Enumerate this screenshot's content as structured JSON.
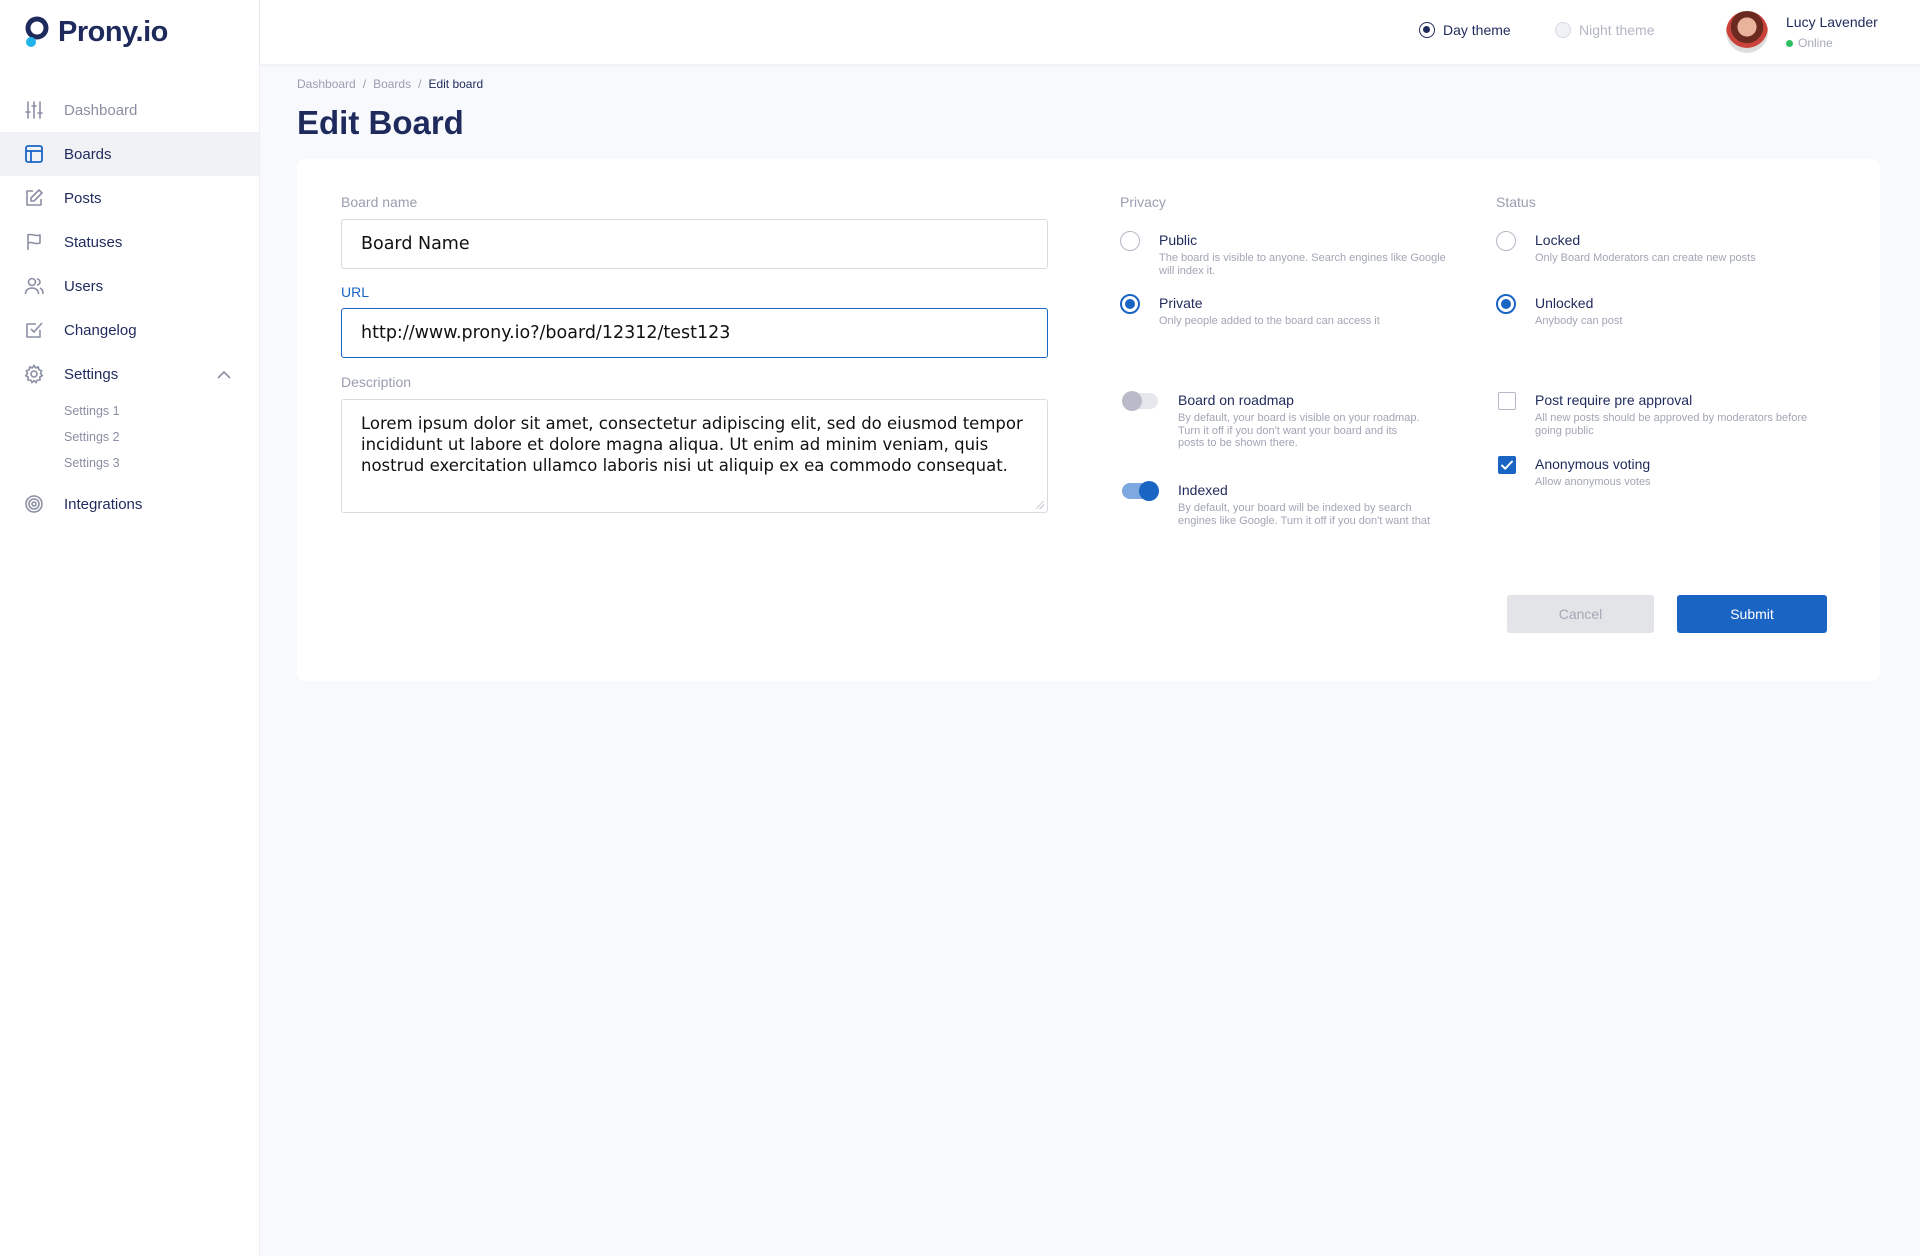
{
  "brand": {
    "name": "Prony.io"
  },
  "sidebar": {
    "items": [
      {
        "label": "Dashboard",
        "icon": "sliders-icon"
      },
      {
        "label": "Boards",
        "icon": "board-icon"
      },
      {
        "label": "Posts",
        "icon": "edit-icon"
      },
      {
        "label": "Statuses",
        "icon": "flag-icon"
      },
      {
        "label": "Users",
        "icon": "users-icon"
      },
      {
        "label": "Changelog",
        "icon": "checked-box-icon"
      },
      {
        "label": "Settings",
        "icon": "gear-icon"
      },
      {
        "label": "Integrations",
        "icon": "target-icon"
      }
    ],
    "settings_sub": [
      "Settings 1",
      "Settings 2",
      "Settings 3"
    ],
    "active": "Boards"
  },
  "header": {
    "day_theme": "Day theme",
    "night_theme": "Night theme",
    "user_name": "Lucy Lavender",
    "user_status": "Online"
  },
  "breadcrumb": [
    "Dashboard",
    "Boards",
    "Edit board"
  ],
  "page_title": "Edit Board",
  "form": {
    "board_name_label": "Board name",
    "board_name_value": "Board Name",
    "url_label": "URL",
    "url_value": "http://www.prony.io?/board/12312/test123",
    "description_label": "Description",
    "description_value": "Lorem ipsum dolor sit amet, consectetur adipiscing elit, sed do eiusmod tempor incididunt ut labore et dolore magna aliqua. Ut enim ad minim veniam, quis nostrud exercitation ullamco laboris nisi ut aliquip ex ea commodo consequat."
  },
  "privacy": {
    "label": "Privacy",
    "public_title": "Public",
    "public_desc": "The board is visible to anyone. Search engines like Google will index it.",
    "private_title": "Private",
    "private_desc": "Only people added to the board can access it",
    "selected": "Private"
  },
  "status": {
    "label": "Status",
    "locked_title": "Locked",
    "locked_desc": "Only Board Moderators can create new posts",
    "unlocked_title": "Unlocked",
    "unlocked_desc": "Anybody can post",
    "selected": "Unlocked"
  },
  "toggles": {
    "roadmap_title": "Board on roadmap",
    "roadmap_desc": "By default, your board is visible on your roadmap. Turn it off if you don't want your board and its posts to be shown there.",
    "roadmap_on": false,
    "indexed_title": "Indexed",
    "indexed_desc": "By default, your board will be indexed by search engines like Google. Turn it off if you don't want that",
    "indexed_on": true
  },
  "checks": {
    "preapproval_title": "Post require pre approval",
    "preapproval_desc": "All new posts should be approved by moderators before going public",
    "preapproval_checked": false,
    "anon_title": "Anonymous voting",
    "anon_desc": "Allow anonymous votes",
    "anon_checked": true
  },
  "actions": {
    "cancel": "Cancel",
    "submit": "Submit"
  },
  "colors": {
    "accent": "#1a64c4",
    "navy": "#1f2a5c",
    "online": "#2fbf60"
  }
}
